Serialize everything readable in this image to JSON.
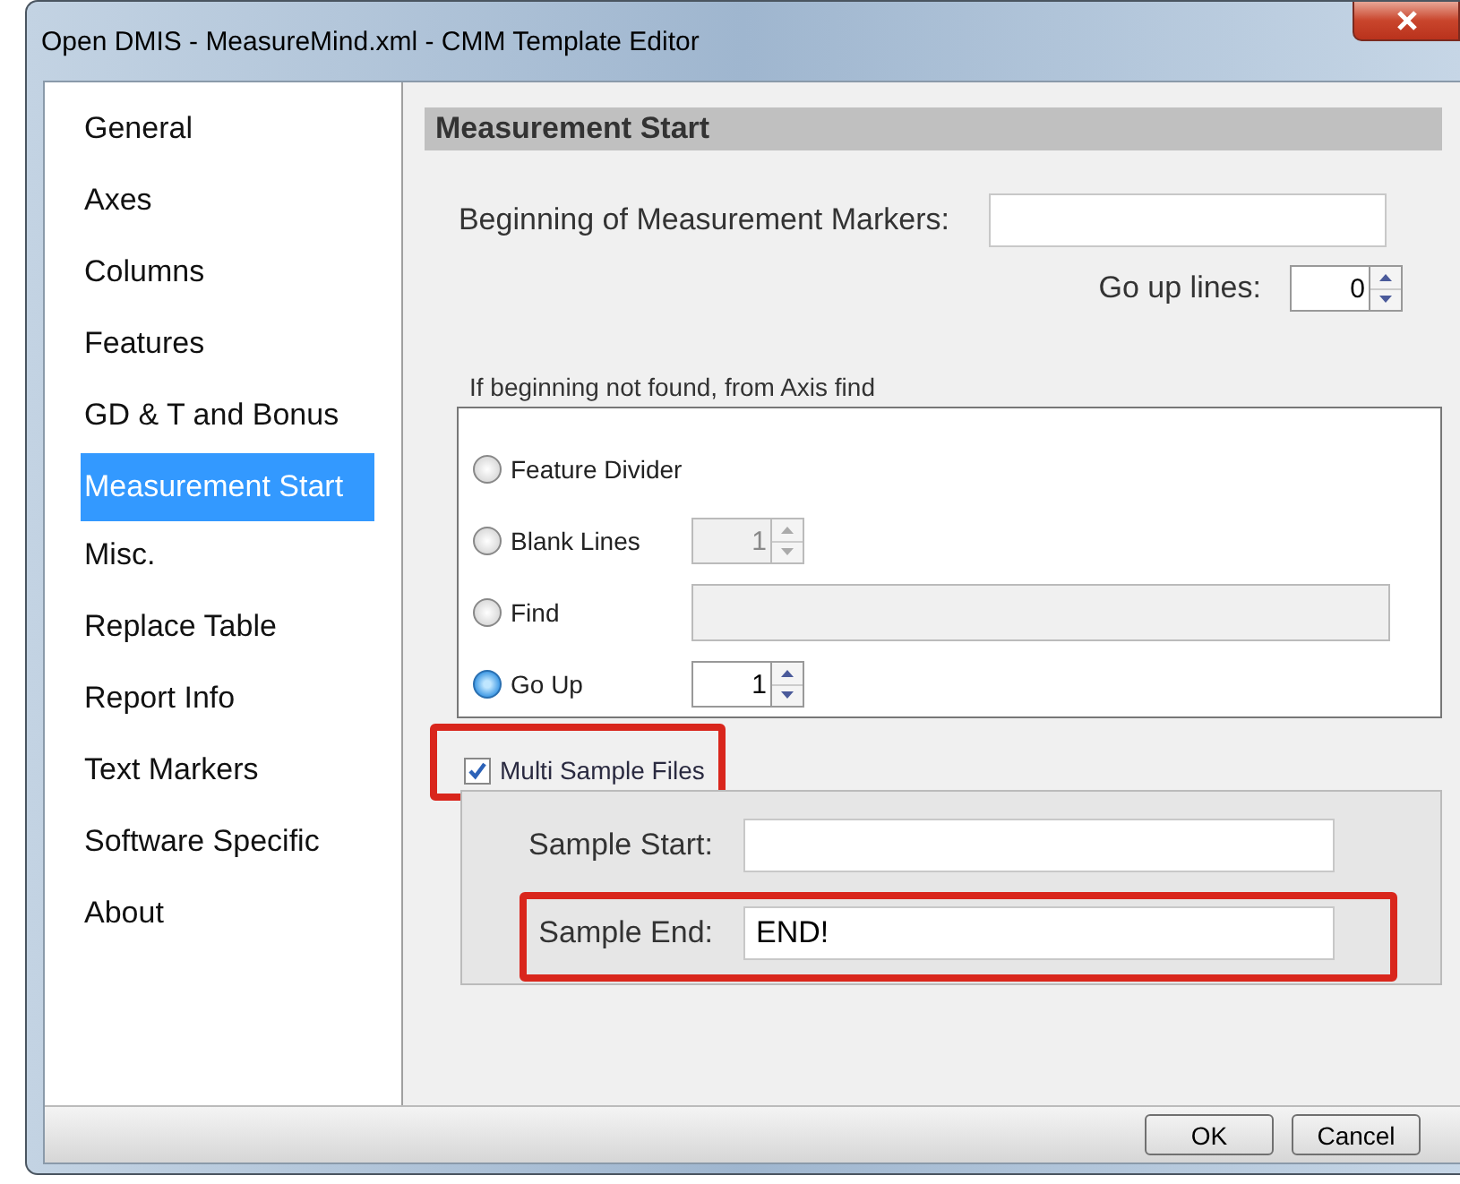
{
  "window": {
    "title": "Open DMIS - MeasureMind.xml - CMM Template Editor"
  },
  "sidebar": {
    "items": [
      {
        "label": "General",
        "selected": false
      },
      {
        "label": "Axes",
        "selected": false
      },
      {
        "label": "Columns",
        "selected": false
      },
      {
        "label": "Features",
        "selected": false
      },
      {
        "label": "GD & T and Bonus",
        "selected": false
      },
      {
        "label": "Measurement Start",
        "selected": true
      },
      {
        "label": "Misc.",
        "selected": false
      },
      {
        "label": "Replace Table",
        "selected": false
      },
      {
        "label": "Report Info",
        "selected": false
      },
      {
        "label": "Text Markers",
        "selected": false
      },
      {
        "label": "Software Specific",
        "selected": false
      },
      {
        "label": "About",
        "selected": false
      }
    ]
  },
  "panel": {
    "title": "Measurement Start",
    "markers_field": {
      "label": "Beginning of Measurement Markers:"
    },
    "go_up_lines": {
      "label": "Go up lines:",
      "value": "0"
    },
    "fallback_group": {
      "title": "If beginning not found, from Axis find",
      "options": [
        {
          "label": "Feature Divider",
          "selected": false,
          "kind": "plain"
        },
        {
          "label": "Blank Lines",
          "selected": false,
          "kind": "spinner",
          "value": "1",
          "disabled": true
        },
        {
          "label": "Find",
          "selected": false,
          "kind": "text",
          "disabled": true
        },
        {
          "label": "Go Up",
          "selected": true,
          "kind": "spinner",
          "value": "1",
          "disabled": false
        }
      ]
    },
    "multi_sample": {
      "label": "Multi Sample Files",
      "checked": true,
      "highlighted": true,
      "fields": [
        {
          "label": "Sample Start:",
          "highlighted": false
        },
        {
          "label": "Sample End:",
          "value": "END!",
          "highlighted": true
        }
      ]
    }
  },
  "buttons": [
    {
      "label": "OK"
    },
    {
      "label": "Cancel"
    }
  ]
}
